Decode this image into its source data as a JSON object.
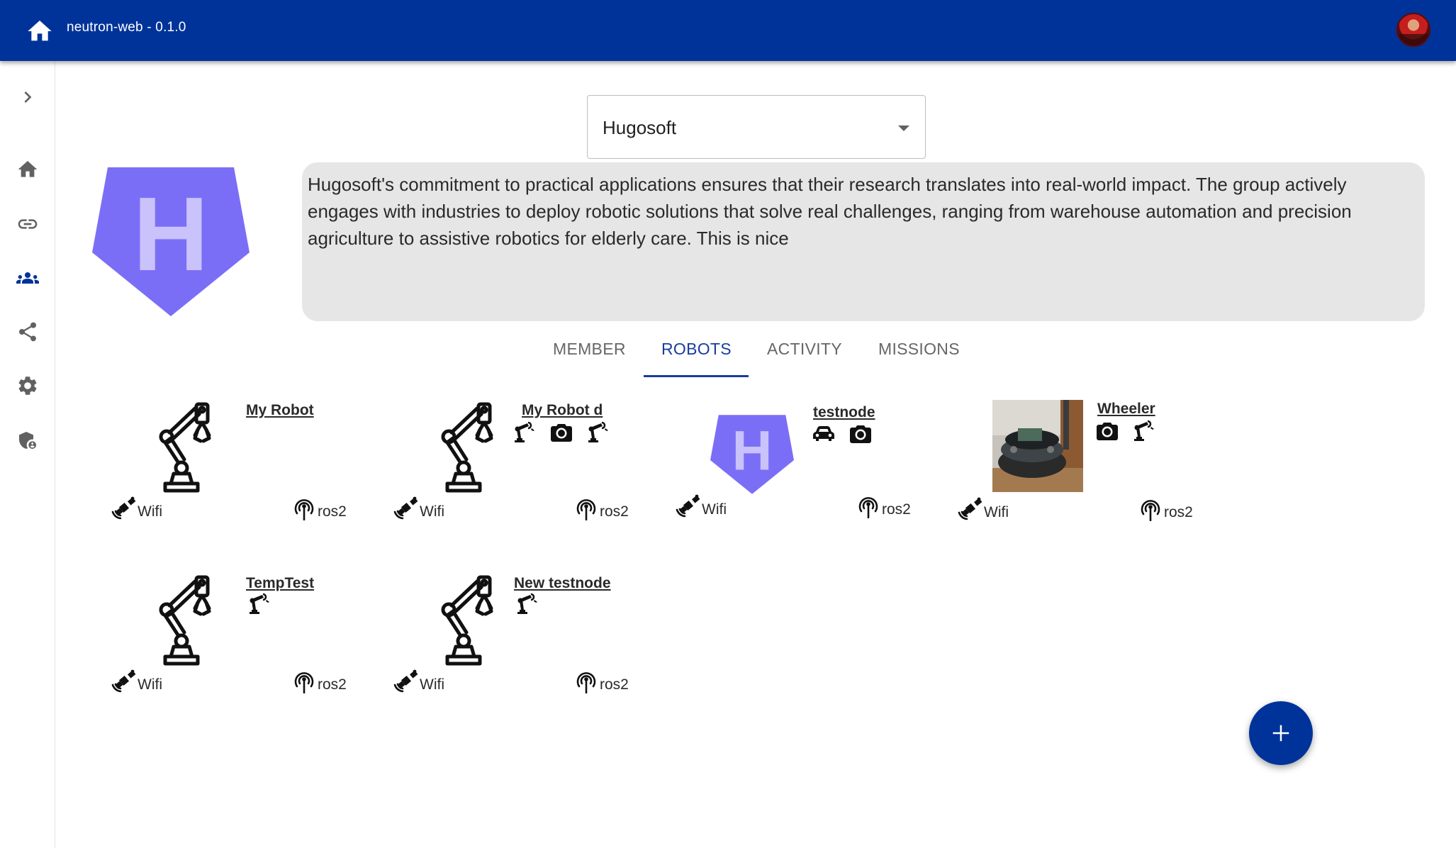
{
  "header": {
    "title": "neutron-web - 0.1.0",
    "home_icon": "home-icon",
    "avatar_icon": "user-avatar"
  },
  "sidebar": {
    "items": [
      {
        "name": "expand",
        "icon": "chevron-right-icon"
      },
      {
        "name": "home",
        "icon": "home-icon"
      },
      {
        "name": "connections",
        "icon": "link-icon"
      },
      {
        "name": "groups",
        "icon": "groups-icon",
        "active": true
      },
      {
        "name": "share",
        "icon": "share-icon"
      },
      {
        "name": "settings",
        "icon": "gear-icon"
      },
      {
        "name": "security",
        "icon": "shield-user-icon"
      }
    ]
  },
  "group": {
    "selected": "Hugosoft",
    "logo_letter": "H",
    "description": "Hugosoft's commitment to practical applications ensures that their research translates into real-world impact. The group actively engages with industries to deploy robotic solutions that solve real challenges, ranging from warehouse automation and precision agriculture to assistive robotics for elderly care. This is nice"
  },
  "tabs": [
    {
      "label": "MEMBER",
      "active": false
    },
    {
      "label": "ROBOTS",
      "active": true
    },
    {
      "label": "ACTIVITY",
      "active": false
    },
    {
      "label": "MISSIONS",
      "active": false
    }
  ],
  "robots": [
    {
      "name": "My Robot",
      "image": "robot-arm",
      "capabilities": [],
      "connection": "Wifi",
      "protocol": "ros2"
    },
    {
      "name": "My Robot d",
      "image": "robot-arm",
      "capabilities": [
        "robot-arm-icon",
        "camera-icon",
        "robot-arm-icon"
      ],
      "connection": "Wifi",
      "protocol": "ros2"
    },
    {
      "name": "testnode",
      "image": "group-logo",
      "capabilities": [
        "car-icon",
        "camera-icon"
      ],
      "connection": "Wifi",
      "protocol": "ros2"
    },
    {
      "name": "Wheeler",
      "image": "robot-photo",
      "capabilities": [
        "camera-icon",
        "robot-arm-icon"
      ],
      "connection": "Wifi",
      "protocol": "ros2"
    },
    {
      "name": "TempTest",
      "image": "robot-arm",
      "capabilities": [
        "robot-arm-icon"
      ],
      "connection": "Wifi",
      "protocol": "ros2"
    },
    {
      "name": "New testnode",
      "image": "robot-arm",
      "capabilities": [
        "robot-arm-icon"
      ],
      "connection": "Wifi",
      "protocol": "ros2"
    }
  ],
  "fab": {
    "label": "+",
    "icon": "plus-icon"
  },
  "colors": {
    "primary": "#003399",
    "logo": "#7b6ef6",
    "logo_letter": "#c9c2fb",
    "description_bg": "#e6e6e6"
  }
}
